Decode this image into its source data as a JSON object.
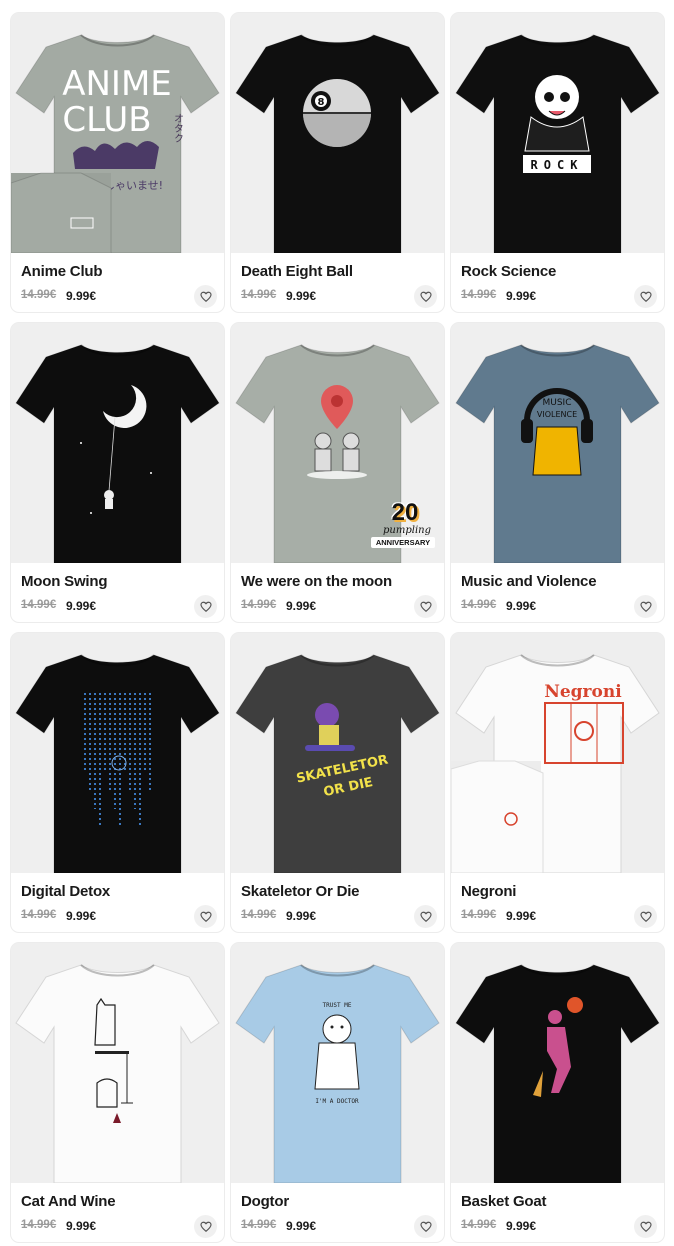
{
  "products": [
    {
      "name": "Anime Club",
      "old_price": "14.99€",
      "price": "9.99€",
      "shirt_color": "#a3aaa3",
      "bg": "#eeeeee",
      "design": "anime",
      "design_text_1": "ANIME",
      "design_text_2": "CLUB",
      "design_text_3": "いらっしゃいませ!",
      "design_text_4": "オタク"
    },
    {
      "name": "Death Eight Ball",
      "old_price": "14.99€",
      "price": "9.99€",
      "shirt_color": "#0f0f0f",
      "bg": "#efefef",
      "design": "deathball",
      "design_text_1": "8"
    },
    {
      "name": "Rock Science",
      "old_price": "14.99€",
      "price": "9.99€",
      "shirt_color": "#0f0f0f",
      "bg": "#efefef",
      "design": "rock",
      "design_text_1": "ROCK"
    },
    {
      "name": "Moon Swing",
      "old_price": "14.99€",
      "price": "9.99€",
      "shirt_color": "#0d0d0d",
      "bg": "#efefef",
      "design": "moon"
    },
    {
      "name": "We were on the moon",
      "old_price": "14.99€",
      "price": "9.99€",
      "shirt_color": "#a7aea7",
      "bg": "#efefef",
      "design": "pin",
      "badge_num": "20",
      "badge_script": "pumpling",
      "badge_anniv": "ANNIVERSARY"
    },
    {
      "name": "Music and Violence",
      "old_price": "14.99€",
      "price": "9.99€",
      "shirt_color": "#607a8e",
      "bg": "#efefef",
      "design": "music",
      "design_text_1": "MUSIC",
      "design_text_2": "VIOLENCE"
    },
    {
      "name": "Digital Detox",
      "old_price": "14.99€",
      "price": "9.99€",
      "shirt_color": "#0d0d0d",
      "bg": "#efefef",
      "design": "matrix"
    },
    {
      "name": "Skateletor Or Die",
      "old_price": "14.99€",
      "price": "9.99€",
      "shirt_color": "#3e3e3e",
      "bg": "#efefef",
      "design": "skate",
      "design_text_1": "SKATELETOR",
      "design_text_2": "OR DIE"
    },
    {
      "name": "Negroni",
      "old_price": "14.99€",
      "price": "9.99€",
      "shirt_color": "#fbfbfb",
      "bg": "#eeeeee",
      "design": "negroni",
      "design_text_1": "Negroni"
    },
    {
      "name": "Cat And Wine",
      "old_price": "14.99€",
      "price": "9.99€",
      "shirt_color": "#fbfbfb",
      "bg": "#efefef",
      "design": "cat"
    },
    {
      "name": "Dogtor",
      "old_price": "14.99€",
      "price": "9.99€",
      "shirt_color": "#a8cbe6",
      "bg": "#efefef",
      "design": "dog",
      "design_text_1": "TRUST ME",
      "design_text_2": "I'M A DOCTOR"
    },
    {
      "name": "Basket Goat",
      "old_price": "14.99€",
      "price": "9.99€",
      "shirt_color": "#0d0d0d",
      "bg": "#efefef",
      "design": "goat"
    }
  ],
  "icons": {
    "favorite": "heart-outline-icon"
  },
  "colors": {
    "text": "#1a1a1a",
    "old_price": "#9a9a9a",
    "fav_bg": "#f0f0f0"
  }
}
